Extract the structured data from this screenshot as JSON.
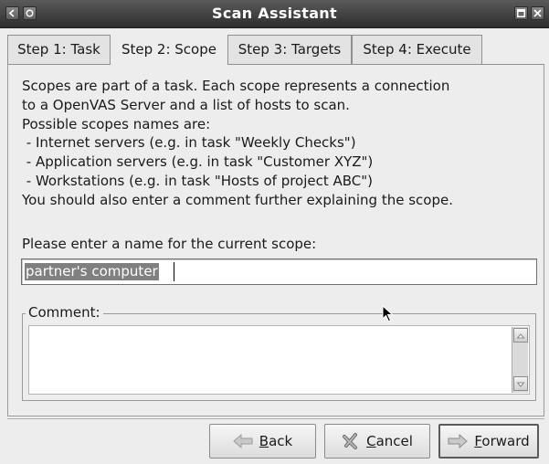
{
  "window": {
    "title": "Scan Assistant"
  },
  "tabs": [
    {
      "label": "Step 1: Task",
      "active": false
    },
    {
      "label": "Step 2: Scope",
      "active": true
    },
    {
      "label": "Step 3: Targets",
      "active": false
    },
    {
      "label": "Step 4: Execute",
      "active": false
    }
  ],
  "intro": {
    "lines": [
      "Scopes are part of a task. Each scope represents a connection",
      "to a OpenVAS Server and a list of hosts to scan.",
      "Possible scopes names are:",
      " - Internet servers (e.g. in task \"Weekly Checks\")",
      " - Application servers (e.g. in task \"Customer XYZ\")",
      " - Workstations (e.g. in task \"Hosts of project ABC\")",
      "You should also enter a comment further explaining the scope."
    ]
  },
  "scope_name": {
    "label": "Please enter a name for the current scope:",
    "value": "partner's computer"
  },
  "comment": {
    "label": "Comment:",
    "value": ""
  },
  "buttons": {
    "back": {
      "prefix": "",
      "mnemonic": "B",
      "rest": "ack"
    },
    "cancel": {
      "prefix": "",
      "mnemonic": "C",
      "rest": "ancel"
    },
    "forward": {
      "prefix": "",
      "mnemonic": "F",
      "rest": "orward"
    }
  },
  "icons": {
    "window_menu": "window-menu-icon",
    "window_sticky": "sticky-icon",
    "maximize": "maximize-icon",
    "close": "close-icon",
    "back": "arrow-left-icon",
    "cancel": "cancel-icon",
    "forward": "arrow-right-icon"
  }
}
